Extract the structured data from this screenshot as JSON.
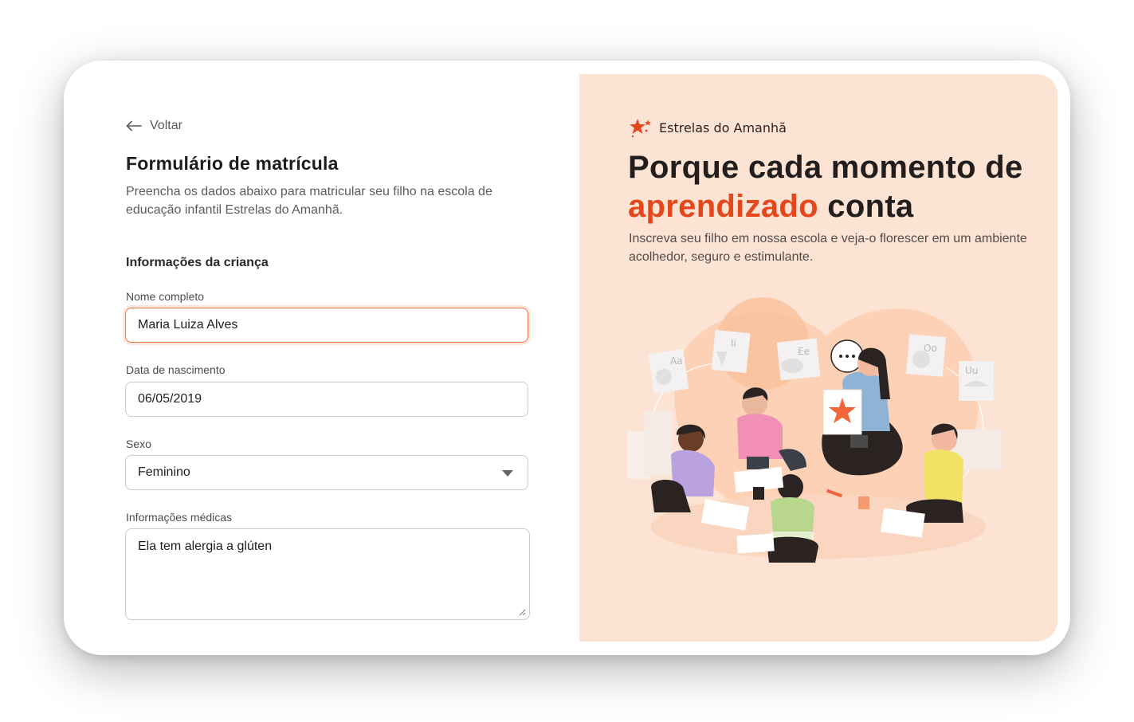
{
  "form": {
    "back_label": "Voltar",
    "title": "Formulário de matrícula",
    "description": "Preencha os dados abaixo para matricular seu filho na escola de educação infantil Estrelas do Amanhã.",
    "section_title": "Informações da criança",
    "fields": {
      "name": {
        "label": "Nome completo",
        "value": "Maria Luiza Alves"
      },
      "birthdate": {
        "label": "Data de nascimento",
        "value": "06/05/2019"
      },
      "sex": {
        "label": "Sexo",
        "value": "Feminino"
      },
      "medical": {
        "label": "Informações médicas",
        "value": "Ela tem alergia a glúten"
      }
    }
  },
  "promo": {
    "brand_name": "Estrelas do Amanhã",
    "headline_pre": "Porque cada momento de ",
    "headline_accent": "aprendizado",
    "headline_post": " conta",
    "subtitle": "Inscreva seu filho em nossa escola e veja-o florescer em um ambiente acolhedor, seguro e estimulante."
  },
  "illustration_cards": [
    "Aa",
    "Ii",
    "Ee",
    "Oo",
    "Uu"
  ],
  "colors": {
    "accent": "#e5471d",
    "panel_bg": "#fde3d3",
    "focus": "#f07a45"
  }
}
